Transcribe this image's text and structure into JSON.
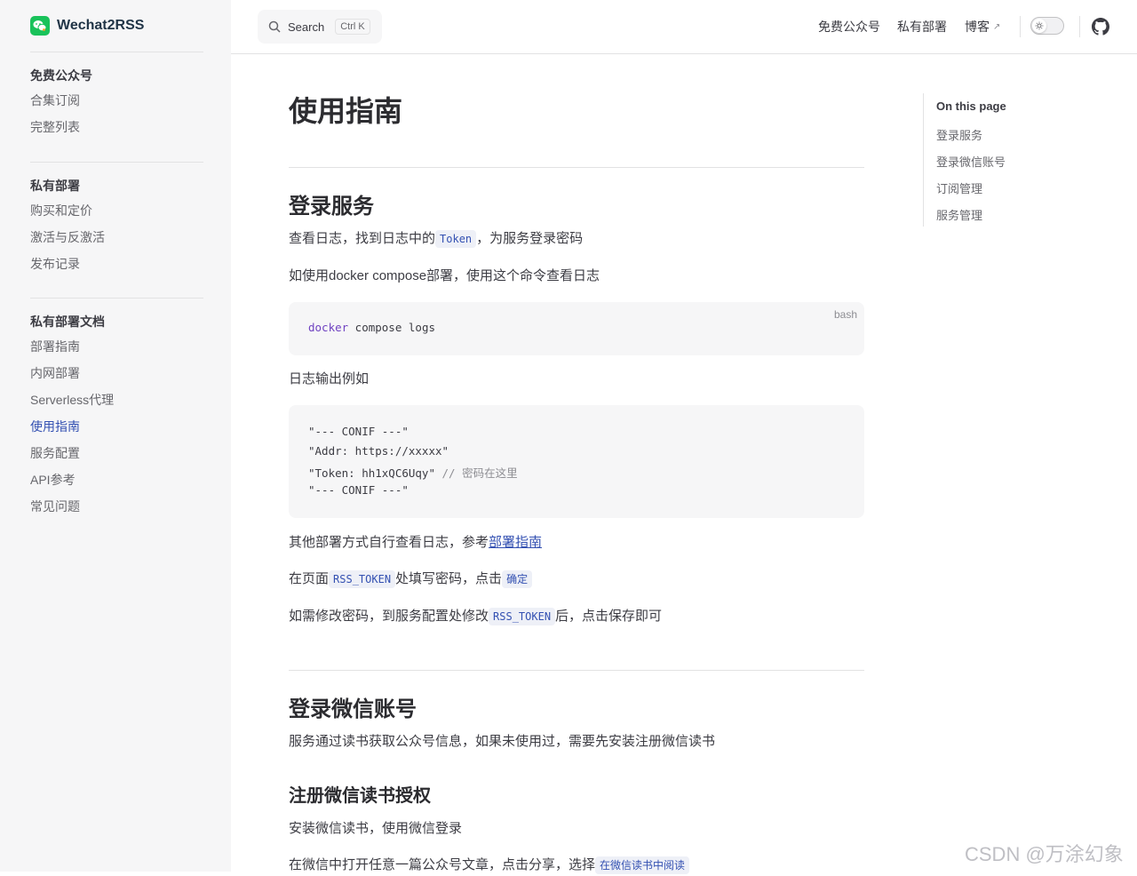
{
  "app": {
    "name": "Wechat2RSS"
  },
  "search": {
    "label": "Search",
    "shortcut": "Ctrl K"
  },
  "nav": [
    {
      "label": "免费公众号"
    },
    {
      "label": "私有部署"
    },
    {
      "label": "博客",
      "external": "↗"
    }
  ],
  "sidebar": {
    "groups": [
      {
        "title": "免费公众号",
        "items": [
          "合集订阅",
          "完整列表"
        ]
      },
      {
        "title": "私有部署",
        "items": [
          "购买和定价",
          "激活与反激活",
          "发布记录"
        ]
      },
      {
        "title": "私有部署文档",
        "items": [
          "部署指南",
          "内网部署",
          "Serverless代理",
          "使用指南",
          "服务配置",
          "API参考",
          "常见问题"
        ],
        "active": "使用指南"
      }
    ]
  },
  "page": {
    "title": "使用指南",
    "sections": {
      "login_service": {
        "heading": "登录服务",
        "p1_before": "查看日志，找到日志中的",
        "p1_code": "Token",
        "p1_after": "，为服务登录密码",
        "p2": "如使用docker compose部署，使用这个命令查看日志",
        "code1": {
          "lang": "bash",
          "cmd": "docker",
          "args": " compose logs"
        },
        "p3": "日志输出例如",
        "code2": [
          {
            "str": "\"--- CONIF ---\"",
            "comment": ""
          },
          {
            "str": "\"Addr: https://xxxxx\"",
            "comment": ""
          },
          {
            "str": "\"Token: hh1xQC6Uqy\"",
            "comment": " // 密码在这里"
          },
          {
            "str": "\"--- CONIF ---\"",
            "comment": ""
          }
        ],
        "p4_before": "其他部署方式自行查看日志，参考",
        "p4_link": "部署指南",
        "p5_before": "在页面",
        "p5_code": "RSS_TOKEN",
        "p5_mid": "处填写密码，点击",
        "p5_code2": "确定",
        "p6_before": "如需修改密码，到服务配置处修改",
        "p6_code": "RSS_TOKEN",
        "p6_after": "后，点击保存即可"
      },
      "login_wechat": {
        "heading": "登录微信账号",
        "p1": "服务通过读书获取公众号信息，如果未使用过，需要先安装注册微信读书",
        "sub_heading": "注册微信读书授权",
        "p2": "安装微信读书，使用微信登录",
        "p3_before": "在微信中打开任意一篇公众号文章，点击分享，选择",
        "p3_code": "在微信读书中阅读"
      }
    }
  },
  "toc": {
    "title": "On this page",
    "items": [
      "登录服务",
      "登录微信账号",
      "订阅管理",
      "服务管理"
    ]
  },
  "watermark": "CSDN @万涂幻象",
  "colors": {
    "accent": "#3451b2",
    "brand_green": "#19c25a"
  }
}
